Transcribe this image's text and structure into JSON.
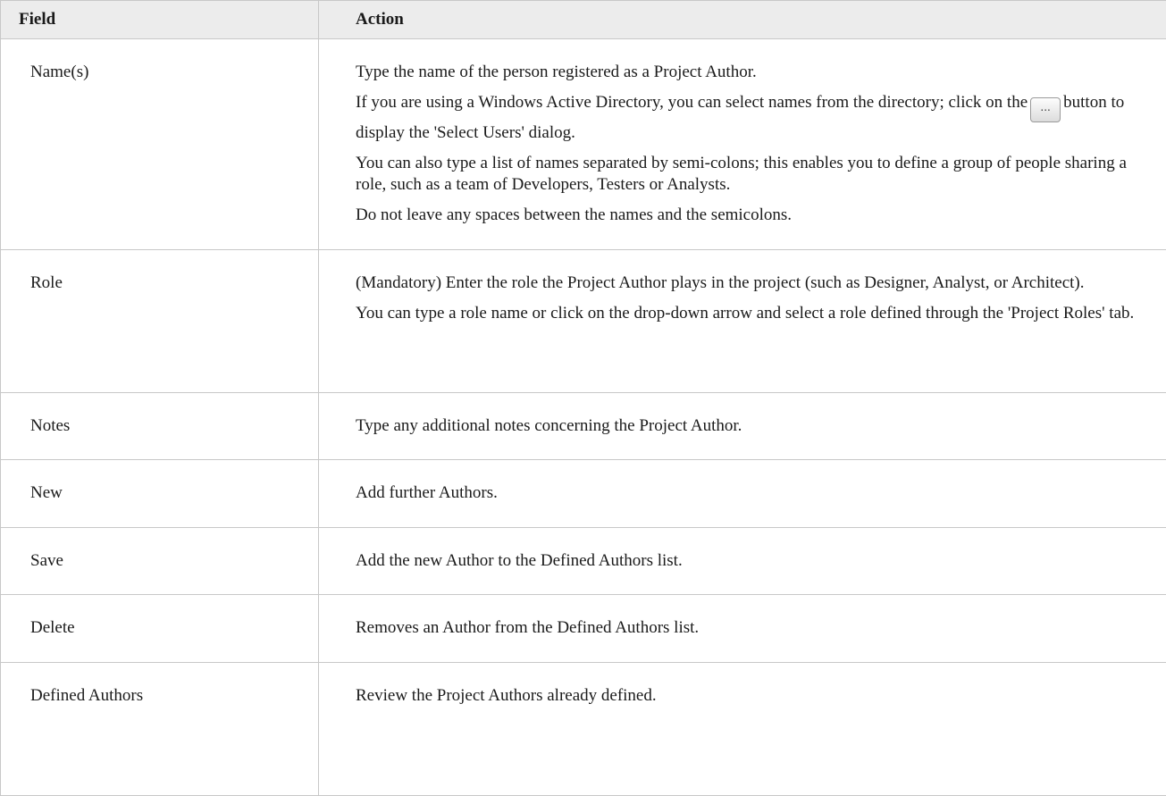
{
  "table": {
    "headers": {
      "field": "Field",
      "action": "Action"
    },
    "rows": [
      {
        "field": "Name(s)",
        "action": [
          "Type the name of the person registered as a Project Author.",
          "If you are using a Windows Active Directory, you can select names from the directory; click on the",
          "button to display the 'Select Users' dialog.",
          "You can also type a list of names separated by semi-colons; this enables you to define a group of people sharing a role, such as a team of Developers, Testers or Analysts.",
          "Do not leave any spaces between the names and the semicolons."
        ],
        "button_label": "..."
      },
      {
        "field": "Role",
        "action": [
          "(Mandatory) Enter the role the Project Author plays in the project (such as Designer, Analyst, or Architect).",
          "You can type a role name or click on the drop-down arrow and select a role defined through the 'Project Roles' tab."
        ]
      },
      {
        "field": "Notes",
        "action": [
          "Type any additional notes concerning the Project Author."
        ]
      },
      {
        "field": "New",
        "action": [
          "Add further Authors."
        ]
      },
      {
        "field": "Save",
        "action": [
          "Add the new Author to the Defined Authors list."
        ]
      },
      {
        "field": "Delete",
        "action": [
          "Removes an Author from the Defined Authors list."
        ]
      },
      {
        "field": "Defined Authors",
        "action": [
          "Review the Project Authors already defined."
        ]
      }
    ]
  }
}
